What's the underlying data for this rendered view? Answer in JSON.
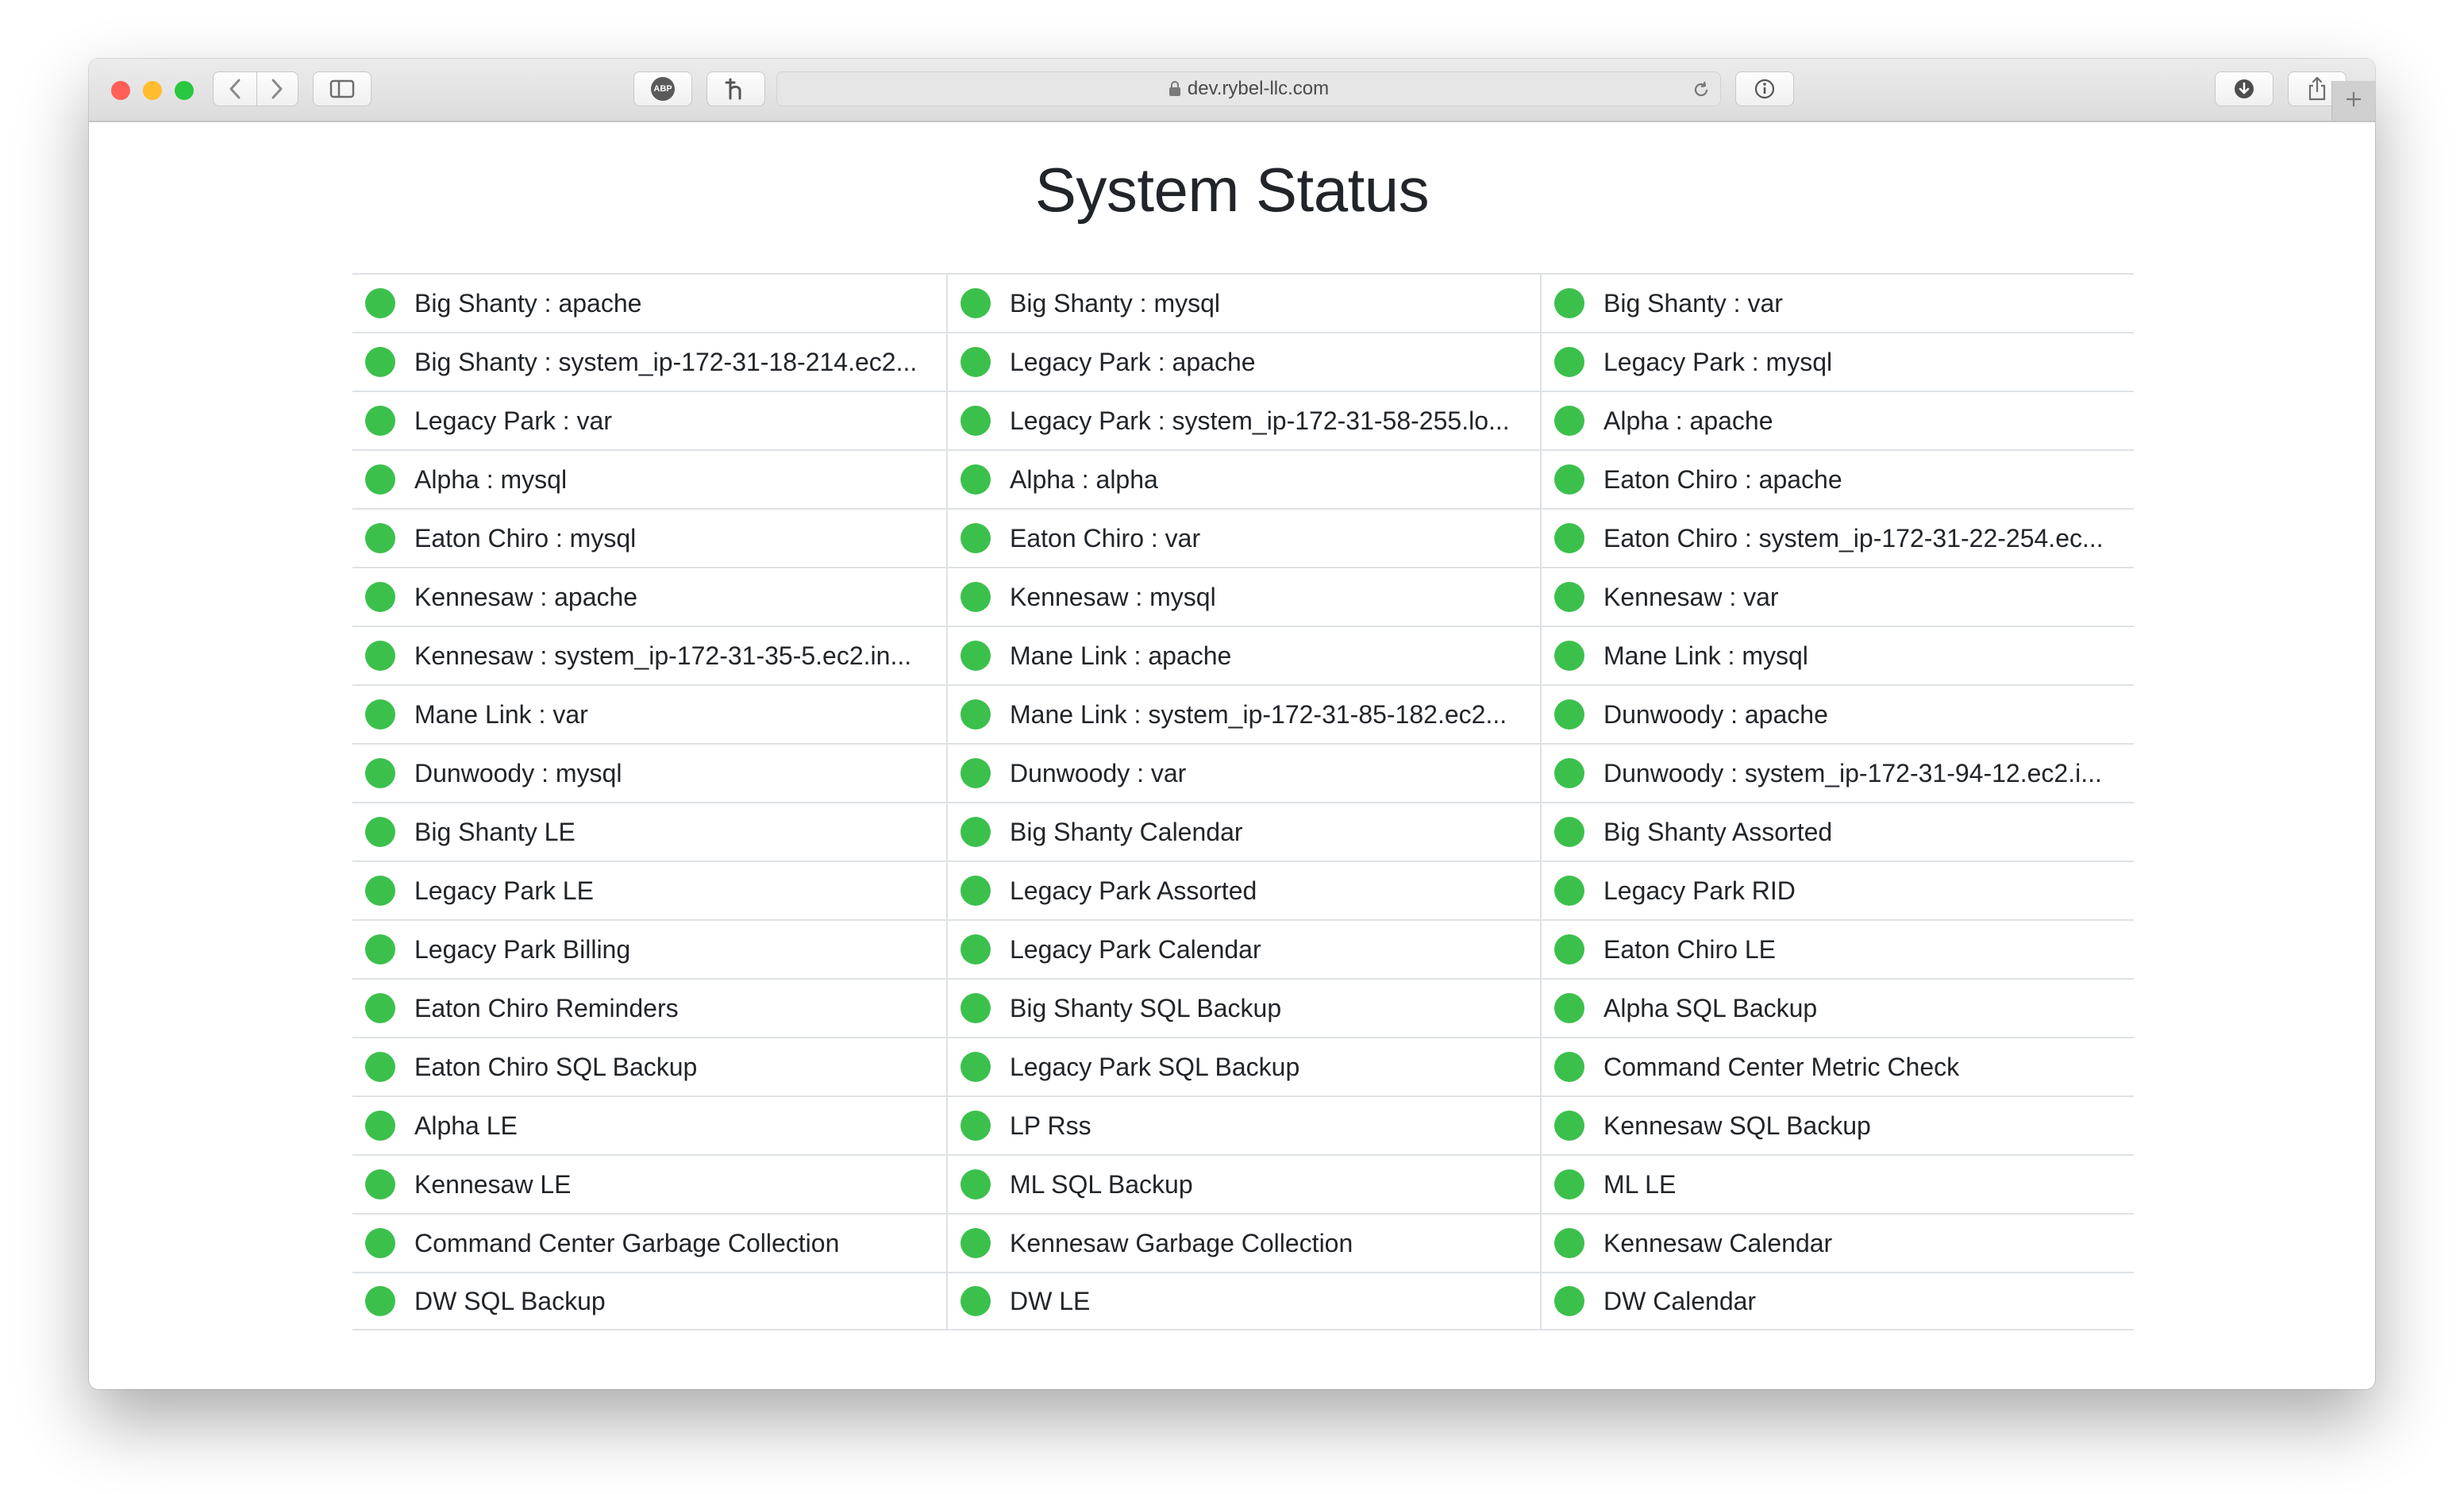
{
  "browser": {
    "url": "dev.rybel-llc.com",
    "colors": {
      "close": "#ff5f57",
      "minimize": "#febc2e",
      "zoom": "#28c840"
    },
    "toolbar_icons": [
      "back-icon",
      "forward-icon",
      "sidebar-icon",
      "adblock-icon",
      "extension-icon",
      "lock-icon",
      "reload-icon",
      "info-icon",
      "download-icon",
      "share-icon",
      "plus-icon"
    ],
    "adblock_label": "ABP"
  },
  "page": {
    "title": "System Status",
    "status_color": "#3cc04c"
  },
  "columns": [
    [
      "Big Shanty : apache",
      "Big Shanty : system_ip-172-31-18-214.ec2...",
      "Legacy Park : var",
      "Alpha : mysql",
      "Eaton Chiro : mysql",
      "Kennesaw : apache",
      "Kennesaw : system_ip-172-31-35-5.ec2.in...",
      "Mane Link : var",
      "Dunwoody : mysql",
      "Big Shanty LE",
      "Legacy Park LE",
      "Legacy Park Billing",
      "Eaton Chiro Reminders",
      "Eaton Chiro SQL Backup",
      "Alpha LE",
      "Kennesaw LE",
      "Command Center Garbage Collection",
      "DW SQL Backup"
    ],
    [
      "Big Shanty : mysql",
      "Legacy Park : apache",
      "Legacy Park : system_ip-172-31-58-255.lo...",
      "Alpha : alpha",
      "Eaton Chiro : var",
      "Kennesaw : mysql",
      "Mane Link : apache",
      "Mane Link : system_ip-172-31-85-182.ec2...",
      "Dunwoody : var",
      "Big Shanty Calendar",
      "Legacy Park Assorted",
      "Legacy Park Calendar",
      "Big Shanty SQL Backup",
      "Legacy Park SQL Backup",
      "LP Rss",
      "ML SQL Backup",
      "Kennesaw Garbage Collection",
      "DW LE"
    ],
    [
      "Big Shanty : var",
      "Legacy Park : mysql",
      "Alpha : apache",
      "Eaton Chiro : apache",
      "Eaton Chiro : system_ip-172-31-22-254.ec...",
      "Kennesaw : var",
      "Mane Link : mysql",
      "Dunwoody : apache",
      "Dunwoody : system_ip-172-31-94-12.ec2.i...",
      "Big Shanty Assorted",
      "Legacy Park RID",
      "Eaton Chiro LE",
      "Alpha SQL Backup",
      "Command Center Metric Check",
      "Kennesaw SQL Backup",
      "ML LE",
      "Kennesaw Calendar",
      "DW Calendar"
    ]
  ]
}
